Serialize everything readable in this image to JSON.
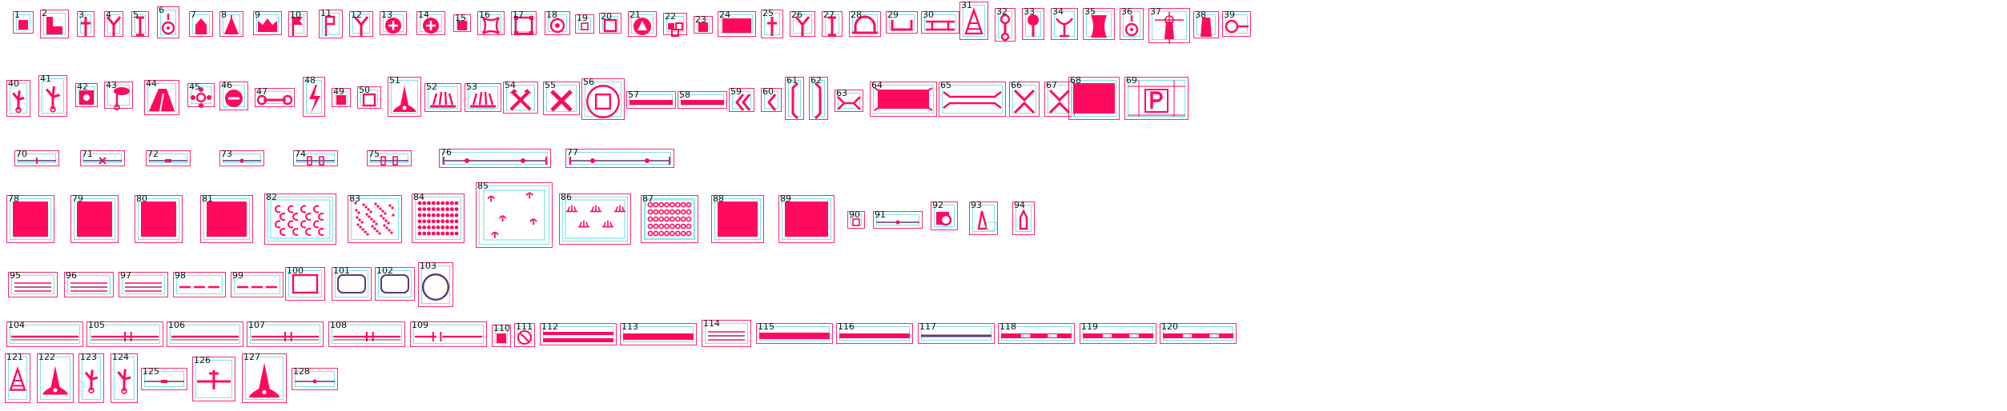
{
  "palette": {
    "symbol": "#ff0a5e",
    "frame": "#ff2a6d",
    "guide": "#7fe3ea",
    "text": "#111111",
    "stroke_dark": "#5a3a78"
  },
  "symbols": [
    {
      "n": "1",
      "glyph": "small-square"
    },
    {
      "n": "2",
      "glyph": "l-block"
    },
    {
      "n": "3",
      "glyph": "pole-cross"
    },
    {
      "n": "4",
      "glyph": "y-post"
    },
    {
      "n": "5",
      "glyph": "i-beam"
    },
    {
      "n": "6",
      "glyph": "pendant"
    },
    {
      "n": "7",
      "glyph": "house"
    },
    {
      "n": "8",
      "glyph": "triangle-tower"
    },
    {
      "n": "9",
      "glyph": "crown"
    },
    {
      "n": "10",
      "glyph": "flag"
    },
    {
      "n": "11",
      "glyph": "flag-box"
    },
    {
      "n": "12",
      "glyph": "y-post"
    },
    {
      "n": "13",
      "glyph": "circle-plus"
    },
    {
      "n": "14",
      "glyph": "circle-plus"
    },
    {
      "n": "15",
      "glyph": "small-square"
    },
    {
      "n": "16",
      "glyph": "concave-square"
    },
    {
      "n": "17",
      "glyph": "notched-square"
    },
    {
      "n": "18",
      "glyph": "ring-dot"
    },
    {
      "n": "19",
      "glyph": "tiny-square"
    },
    {
      "n": "20",
      "glyph": "hollow-square"
    },
    {
      "n": "21",
      "glyph": "circle-triangle"
    },
    {
      "n": "22",
      "glyph": "cross-blocks"
    },
    {
      "n": "23",
      "glyph": "small-square"
    },
    {
      "n": "24",
      "glyph": "rect"
    },
    {
      "n": "25",
      "glyph": "pole-cross"
    },
    {
      "n": "26",
      "glyph": "y-post"
    },
    {
      "n": "27",
      "glyph": "i-beam"
    },
    {
      "n": "28",
      "glyph": "arch"
    },
    {
      "n": "29",
      "glyph": "u-channel"
    },
    {
      "n": "30",
      "glyph": "bridge"
    },
    {
      "n": "31",
      "glyph": "tower"
    },
    {
      "n": "32",
      "glyph": "chain"
    },
    {
      "n": "33",
      "glyph": "lollipop"
    },
    {
      "n": "34",
      "glyph": "dish"
    },
    {
      "n": "35",
      "glyph": "cooling-tower"
    },
    {
      "n": "36",
      "glyph": "pendant"
    },
    {
      "n": "37",
      "glyph": "lighthouse"
    },
    {
      "n": "38",
      "glyph": "chimney"
    },
    {
      "n": "39",
      "glyph": "circle-line"
    },
    {
      "n": "40",
      "glyph": "windmill"
    },
    {
      "n": "41",
      "glyph": "windmill"
    },
    {
      "n": "42",
      "glyph": "cog-box"
    },
    {
      "n": "43",
      "glyph": "signpost"
    },
    {
      "n": "44",
      "glyph": "tent"
    },
    {
      "n": "45",
      "glyph": "flower"
    },
    {
      "n": "46",
      "glyph": "circle-minus"
    },
    {
      "n": "47",
      "glyph": "bone"
    },
    {
      "n": "48",
      "glyph": "bolt"
    },
    {
      "n": "49",
      "glyph": "small-square"
    },
    {
      "n": "50",
      "glyph": "hollow-square"
    },
    {
      "n": "51",
      "glyph": "bell-tower"
    },
    {
      "n": "52",
      "glyph": "radiator"
    },
    {
      "n": "53",
      "glyph": "radiator"
    },
    {
      "n": "54",
      "glyph": "hammer-pick"
    },
    {
      "n": "55",
      "glyph": "crossed"
    },
    {
      "n": "56",
      "glyph": "world-heritage"
    },
    {
      "n": "57",
      "glyph": "bar"
    },
    {
      "n": "58",
      "glyph": "bar"
    },
    {
      "n": "59",
      "glyph": "double-chevron"
    },
    {
      "n": "60",
      "glyph": "chevron"
    },
    {
      "n": "61",
      "glyph": "bracket-left"
    },
    {
      "n": "62",
      "glyph": "bracket-right"
    },
    {
      "n": "63",
      "glyph": "pinch"
    },
    {
      "n": "64",
      "glyph": "wide-rect"
    },
    {
      "n": "65",
      "glyph": "tapered-lines"
    },
    {
      "n": "66",
      "glyph": "hourglass"
    },
    {
      "n": "67",
      "glyph": "hourglass"
    },
    {
      "n": "68",
      "glyph": "big-rect"
    },
    {
      "n": "69",
      "glyph": "parking"
    },
    {
      "n": "70",
      "glyph": "line-tick"
    },
    {
      "n": "71",
      "glyph": "line-x"
    },
    {
      "n": "72",
      "glyph": "line-block"
    },
    {
      "n": "73",
      "glyph": "line-dot"
    },
    {
      "n": "74",
      "glyph": "line-gates"
    },
    {
      "n": "75",
      "glyph": "line-gates"
    },
    {
      "n": "76",
      "glyph": "line-dots"
    },
    {
      "n": "77",
      "glyph": "line-dots"
    },
    {
      "n": "78",
      "glyph": "fill-rect"
    },
    {
      "n": "79",
      "glyph": "fill-rect"
    },
    {
      "n": "80",
      "glyph": "fill-rect"
    },
    {
      "n": "81",
      "glyph": "fill-rect"
    },
    {
      "n": "82",
      "glyph": "pattern-c"
    },
    {
      "n": "83",
      "glyph": "pattern-dots"
    },
    {
      "n": "84",
      "glyph": "pattern-grid"
    },
    {
      "n": "85",
      "glyph": "pattern-trees"
    },
    {
      "n": "86",
      "glyph": "pattern-grass"
    },
    {
      "n": "87",
      "glyph": "pattern-rings"
    },
    {
      "n": "88",
      "glyph": "fill-rect"
    },
    {
      "n": "89",
      "glyph": "fill-rect"
    },
    {
      "n": "90",
      "glyph": "tiny-square"
    },
    {
      "n": "91",
      "glyph": "line-dot"
    },
    {
      "n": "92",
      "glyph": "ring-square"
    },
    {
      "n": "93",
      "glyph": "triangle-box"
    },
    {
      "n": "94",
      "glyph": "hand"
    },
    {
      "n": "95",
      "glyph": "triple-line"
    },
    {
      "n": "96",
      "glyph": "triple-line"
    },
    {
      "n": "97",
      "glyph": "triple-line"
    },
    {
      "n": "98",
      "glyph": "dash-line"
    },
    {
      "n": "99",
      "glyph": "dash-line"
    },
    {
      "n": "100",
      "glyph": "hollow-rect"
    },
    {
      "n": "101",
      "glyph": "round-rect"
    },
    {
      "n": "102",
      "glyph": "round-rect"
    },
    {
      "n": "103",
      "glyph": "circle"
    },
    {
      "n": "104",
      "glyph": "road"
    },
    {
      "n": "105",
      "glyph": "road-ticks"
    },
    {
      "n": "106",
      "glyph": "road"
    },
    {
      "n": "107",
      "glyph": "road-ticks"
    },
    {
      "n": "108",
      "glyph": "road-ticks"
    },
    {
      "n": "109",
      "glyph": "road-gap"
    },
    {
      "n": "110",
      "glyph": "small-square"
    },
    {
      "n": "111",
      "glyph": "no-entry"
    },
    {
      "n": "112",
      "glyph": "double-bar"
    },
    {
      "n": "113",
      "glyph": "bar-thick"
    },
    {
      "n": "114",
      "glyph": "triple-line"
    },
    {
      "n": "115",
      "glyph": "bar-thick"
    },
    {
      "n": "116",
      "glyph": "bar"
    },
    {
      "n": "117",
      "glyph": "bar-thin"
    },
    {
      "n": "118",
      "glyph": "bar-gaps"
    },
    {
      "n": "119",
      "glyph": "bar-gaps"
    },
    {
      "n": "120",
      "glyph": "bar-gaps"
    },
    {
      "n": "121",
      "glyph": "tower"
    },
    {
      "n": "122",
      "glyph": "bell-tower"
    },
    {
      "n": "123",
      "glyph": "windmill"
    },
    {
      "n": "124",
      "glyph": "windmill"
    },
    {
      "n": "125",
      "glyph": "line-block"
    },
    {
      "n": "126",
      "glyph": "cross-line"
    },
    {
      "n": "127",
      "glyph": "bell-tower"
    },
    {
      "n": "128",
      "glyph": "line-dot"
    }
  ]
}
